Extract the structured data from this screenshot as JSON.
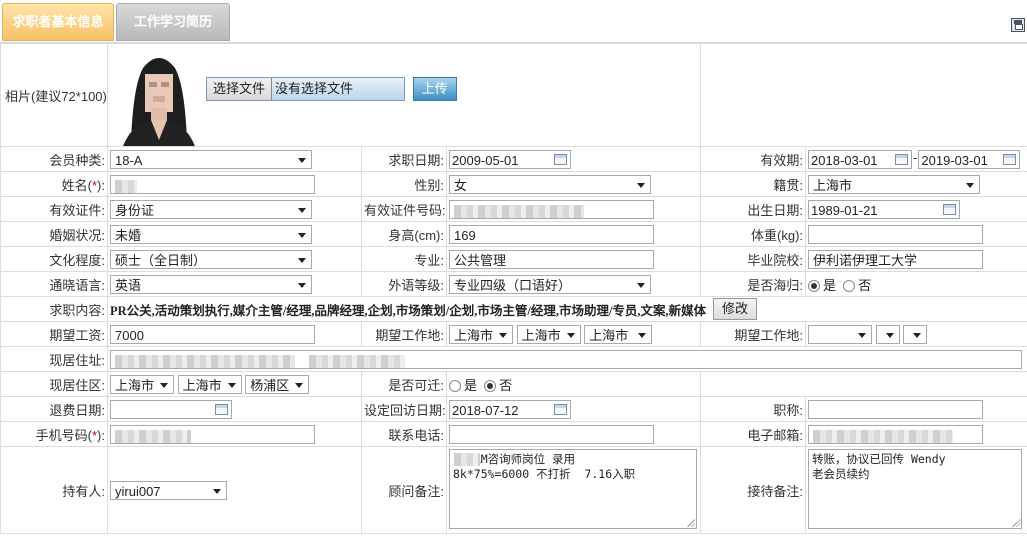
{
  "tabs": {
    "basic_info": "求职者基本信息",
    "experience": "工作学习简历"
  },
  "photo": {
    "label": "相片(建议72*100):",
    "choose_file": "选择文件",
    "no_file": "没有选择文件",
    "upload": "上传"
  },
  "member_type": {
    "label": "会员种类:",
    "value": "18-A"
  },
  "apply_date": {
    "label": "求职日期:",
    "value": "2009-05-01"
  },
  "validity": {
    "label": "有效期:",
    "from": "2018-03-01",
    "sep": "-",
    "to": "2019-03-01"
  },
  "name": {
    "label_pre": "姓名(",
    "label_req": "*",
    "label_post": "):"
  },
  "gender": {
    "label": "性别:",
    "value": "女"
  },
  "native_place": {
    "label": "籍贯:",
    "value": "上海市"
  },
  "id_type": {
    "label": "有效证件:",
    "value": "身份证"
  },
  "id_number": {
    "label": "有效证件号码:"
  },
  "birth_date": {
    "label": "出生日期:",
    "value": "1989-01-21"
  },
  "marital": {
    "label": "婚姻状况:",
    "value": "未婚"
  },
  "height": {
    "label": "身高(cm):",
    "value": "169"
  },
  "weight": {
    "label": "体重(kg):",
    "value": ""
  },
  "education": {
    "label": "文化程度:",
    "value": "硕士（全日制）"
  },
  "major": {
    "label": "专业:",
    "value": "公共管理"
  },
  "school": {
    "label": "毕业院校:",
    "value": "伊利诺伊理工大学"
  },
  "language": {
    "label": "通晓语言:",
    "value": "英语"
  },
  "language_level": {
    "label": "外语等级:",
    "value": "专业四级（口语好）"
  },
  "overseas": {
    "label": "是否海归:",
    "yes": "是",
    "no": "否",
    "selected": "是"
  },
  "job_content": {
    "label": "求职内容:",
    "value": "PR公关,活动策划执行,媒介主管/经理,品牌经理,企划,市场策划/企划,市场主管/经理,市场助理/专员,文案,新媒体",
    "edit": "修改"
  },
  "expected_salary": {
    "label": "期望工资:",
    "value": "7000"
  },
  "expected_location": {
    "label": "期望工作地:",
    "v1": "上海市",
    "v2": "上海市",
    "v3": "上海市"
  },
  "expected_location2": {
    "label": "期望工作地:"
  },
  "address": {
    "label": "现居住址:"
  },
  "district": {
    "label": "现居住区:",
    "v1": "上海市",
    "v2": "上海市",
    "v3": "杨浦区"
  },
  "relocate": {
    "label": "是否可迁:",
    "yes": "是",
    "no": "否",
    "selected": "否"
  },
  "refund_date": {
    "label": "退费日期:",
    "value": ""
  },
  "callback_date": {
    "label": "设定回访日期:",
    "value": "2018-07-12"
  },
  "title": {
    "label": "职称:",
    "value": ""
  },
  "mobile": {
    "label_pre": "手机号码(",
    "label_req": "*",
    "label_post": "):"
  },
  "phone": {
    "label": "联系电话:",
    "value": ""
  },
  "email": {
    "label": "电子邮箱:"
  },
  "holder": {
    "label": "持有人:",
    "value": "yirui007"
  },
  "advisor_note": {
    "label": "顾问备注:",
    "line1": "  CRM咨询师岗位 录用",
    "line2": "8k*75%=6000 不打折  7.16入职"
  },
  "reception_note": {
    "label": "接待备注:",
    "line1": "转账，协议已回传 Wendy",
    "line2": "老会员续约"
  }
}
